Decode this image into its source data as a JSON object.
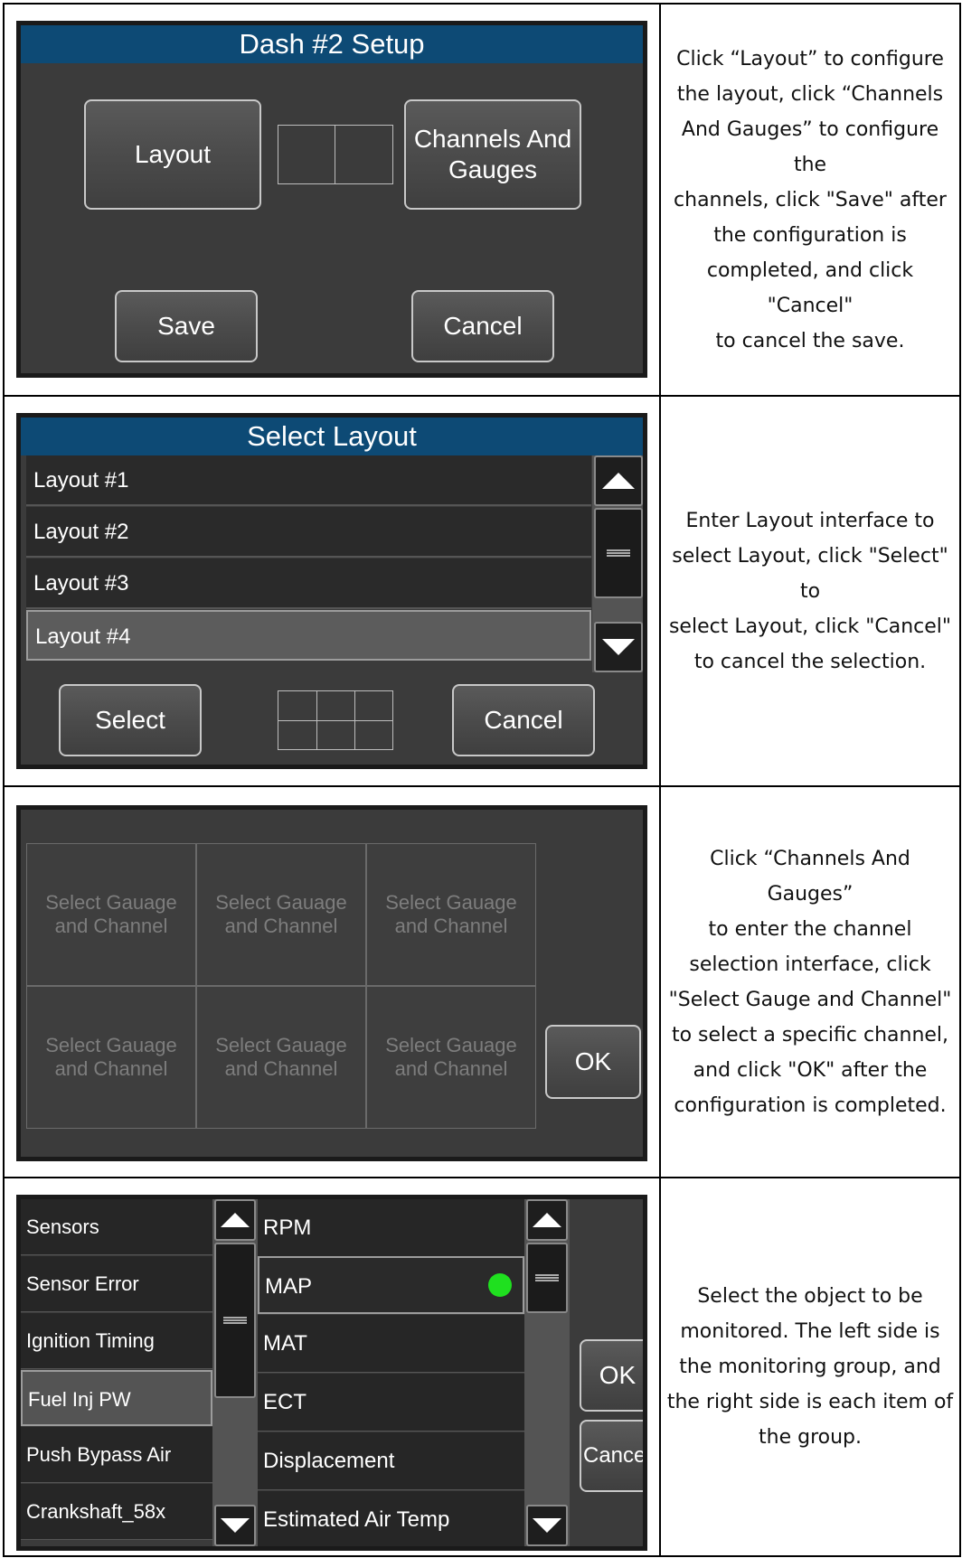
{
  "rows": {
    "setup": {
      "title": "Dash #2 Setup",
      "layout_button": "Layout",
      "channels_button_line1": "Channels And",
      "channels_button_line2": "Gauges",
      "save_button": "Save",
      "cancel_button": "Cancel",
      "desc": [
        "Click “Layout” to configure",
        "the layout, click “Channels",
        "And Gauges” to configure the",
        "channels, click \"Save\" after",
        "the configuration is",
        "completed, and click \"Cancel\"",
        "to cancel the save."
      ]
    },
    "layout": {
      "title": "Select Layout",
      "items": [
        "Layout #1",
        "Layout #2",
        "Layout #3",
        "Layout #4"
      ],
      "selected_index": 3,
      "select_button": "Select",
      "cancel_button": "Cancel",
      "desc": [
        "Enter Layout interface to",
        "select Layout, click \"Select\" to",
        "select Layout, click \"Cancel\"",
        "to cancel the selection."
      ]
    },
    "gauges": {
      "cell_line1": "Select Gauage",
      "cell_line2": "and Channel",
      "ok_button": "OK",
      "desc": [
        "Click “Channels And Gauges”",
        "to enter the channel",
        "selection interface, click",
        "\"Select Gauge and Channel\"",
        "to select a specific channel,",
        "and click \"OK\" after the",
        "configuration is completed."
      ]
    },
    "channels": {
      "groups": [
        "Sensors",
        "Sensor Error",
        "Ignition Timing",
        "Fuel Inj PW",
        "Push Bypass Air",
        "Crankshaft_58x"
      ],
      "selected_group_index": 3,
      "items": [
        "RPM",
        "MAP",
        "MAT",
        "ECT",
        "Displacement",
        "Estimated Air Temp"
      ],
      "selected_item_index": 1,
      "active_dot_color": "#1fe01f",
      "ok_button": "OK",
      "cancel_button": "Cancel",
      "desc": [
        "Select the object to be",
        "monitored. The left side is",
        "the monitoring group, and",
        "the right side is each item of",
        "the group."
      ]
    }
  }
}
